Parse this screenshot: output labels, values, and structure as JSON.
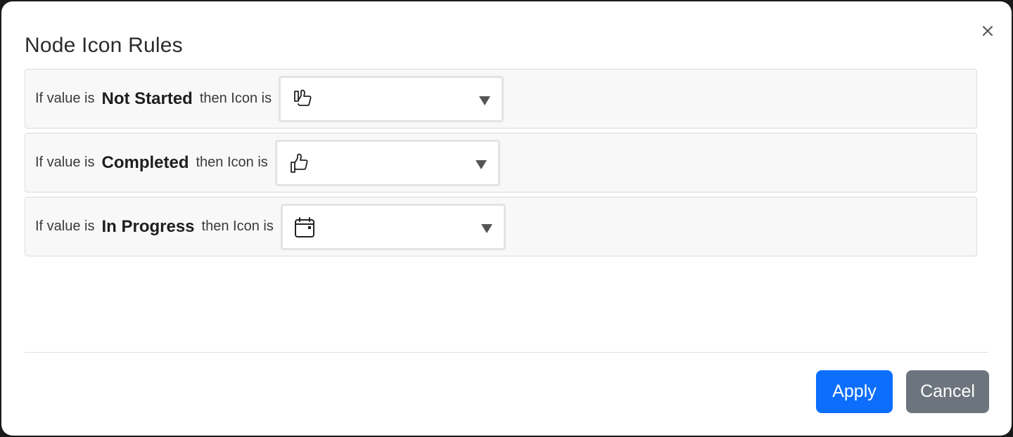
{
  "dialog": {
    "title": "Node Icon Rules",
    "close_label": "×"
  },
  "rules": [
    {
      "prefix": "If value is",
      "value": "Not Started",
      "suffix": "then Icon is",
      "icon": "thumbs-down-icon"
    },
    {
      "prefix": "If value is",
      "value": "Completed",
      "suffix": "then Icon is",
      "icon": "thumbs-up-icon"
    },
    {
      "prefix": "If value is",
      "value": "In Progress",
      "suffix": "then Icon is",
      "icon": "calendar-icon"
    }
  ],
  "footer": {
    "apply_label": "Apply",
    "cancel_label": "Cancel"
  },
  "colors": {
    "primary": "#0d6efd",
    "secondary": "#6c757d",
    "row_background": "#f8f8f8"
  }
}
